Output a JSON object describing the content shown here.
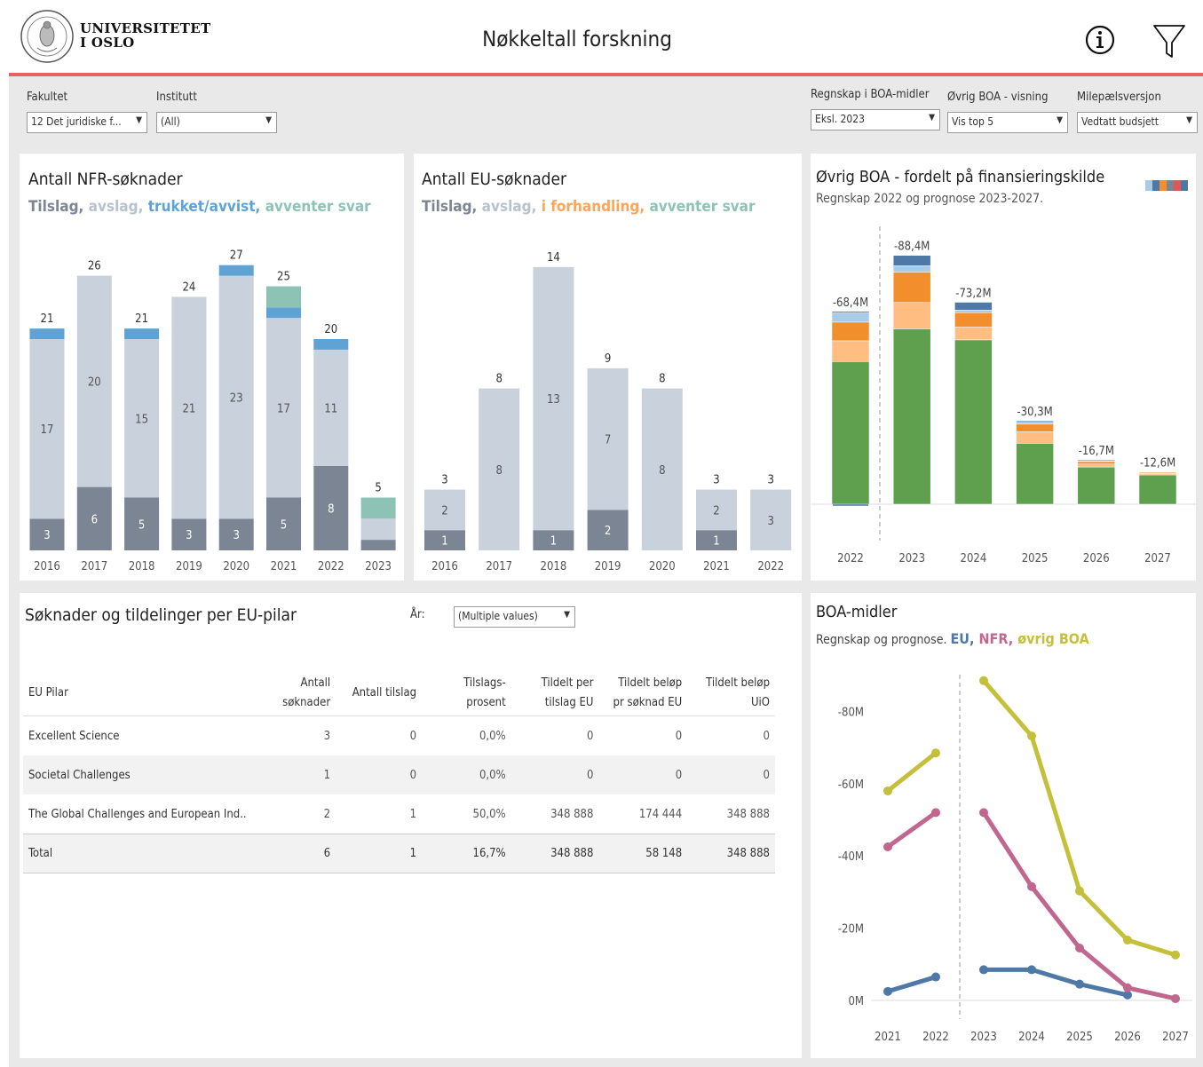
{
  "header": {
    "university_line1": "UNIVERSITETET",
    "university_line2": "I OSLO",
    "title": "Nøkkeltall forskning",
    "info_icon": "info-icon",
    "filter_icon": "filter-icon"
  },
  "filters": {
    "fakultet": {
      "label": "Fakultet",
      "value": "12 Det juridiske f..."
    },
    "institutt": {
      "label": "Institutt",
      "value": "(All)"
    },
    "regnskap": {
      "label": "Regnskap i BOA-midler",
      "value": "Eksl. 2023"
    },
    "ovrig": {
      "label": "Øvrig BOA - visning",
      "value": "Vis top 5"
    },
    "milepael": {
      "label": "Milepælsversjon",
      "value": "Vedtatt budsjett"
    }
  },
  "colors": {
    "tilslag": "#7b8593",
    "avslag": "#c8d1dc",
    "trukket": "#5fa2d4",
    "avventer": "#8cc3b5",
    "forhandling": "#f9a65a",
    "eu_line": "#4e79a7",
    "nfr_line": "#c1668e",
    "boa_line": "#c5c03b",
    "green": "#5fa04e",
    "orange": "#f28e2b",
    "light_orange": "#ffbd82",
    "light_blue": "#a8cce8",
    "dark_blue": "#4e79a7",
    "accent": "#e46464"
  },
  "nfr": {
    "title": "Antall NFR-søknader",
    "legend": {
      "tilslag": "Tilslag",
      "avslag": "avslag",
      "trukket": "trukket/avvist",
      "avventer": "avventer svar",
      "sep": ", "
    }
  },
  "eu": {
    "title": "Antall EU-søknader",
    "legend": {
      "tilslag": "Tilslag",
      "avslag": "avslag",
      "forhandling": "i forhandling",
      "avventer": "avventer svar",
      "sep": ", "
    }
  },
  "ovrig_boa": {
    "title_bold": "Øvrig BOA",
    "title_rest": " - fordelt på finansieringskilde",
    "subtitle": "Regnskap 2022 og prognose 2023-2027."
  },
  "boa_midler": {
    "title": "BOA-midler",
    "subtitle_prefix": "Regnskap og prognose. ",
    "eu": "EU",
    "nfr": "NFR",
    "ovrig": "øvrig BOA",
    "sep": ", "
  },
  "pilar": {
    "title": "Søknader og tildelinger per EU-pilar",
    "year_label": "År:",
    "year_value": "(Multiple values)",
    "columns": [
      [
        "EU Pilar"
      ],
      [
        "Antall",
        "søknader"
      ],
      [
        "Antall tilslag"
      ],
      [
        "Tilslags-",
        "prosent"
      ],
      [
        "Tildelt per",
        "tilslag EU"
      ],
      [
        "Tildelt beløp",
        "pr søknad EU"
      ],
      [
        "Tildelt beløp",
        "UiO"
      ]
    ],
    "rows": [
      [
        "Excellent Science",
        "3",
        "0",
        "0,0%",
        "0",
        "0",
        "0"
      ],
      [
        "Societal Challenges",
        "1",
        "0",
        "0,0%",
        "0",
        "0",
        "0"
      ],
      [
        "The Global Challenges and European Ind..",
        "2",
        "1",
        "50,0%",
        "348 888",
        "174 444",
        "348 888"
      ]
    ],
    "total": [
      "Total",
      "6",
      "1",
      "16,7%",
      "348 888",
      "58 148",
      "348 888"
    ]
  },
  "chart_data": [
    {
      "type": "bar",
      "name": "nfr",
      "stacked": true,
      "categories": [
        "2016",
        "2017",
        "2018",
        "2019",
        "2020",
        "2021",
        "2022",
        "2023"
      ],
      "series": [
        {
          "name": "Tilslag",
          "values": [
            3,
            6,
            5,
            3,
            3,
            5,
            8,
            1
          ]
        },
        {
          "name": "avslag",
          "values": [
            17,
            20,
            15,
            21,
            23,
            17,
            11,
            2
          ]
        },
        {
          "name": "trukket/avvist",
          "values": [
            1,
            0,
            1,
            0,
            1,
            1,
            1,
            0
          ]
        },
        {
          "name": "avventer svar",
          "values": [
            0,
            0,
            0,
            0,
            0,
            2,
            0,
            2
          ]
        }
      ],
      "totals": [
        21,
        26,
        21,
        24,
        27,
        25,
        20,
        5
      ],
      "labels": {
        "tilslag": [
          "3",
          "6",
          "5",
          "3",
          "3",
          "5",
          "8",
          ""
        ],
        "avslag": [
          "17",
          "20",
          "15",
          "21",
          "23",
          "17",
          "11",
          ""
        ]
      },
      "ylim": [
        0,
        30
      ]
    },
    {
      "type": "bar",
      "name": "eu",
      "stacked": true,
      "categories": [
        "2016",
        "2017",
        "2018",
        "2019",
        "2020",
        "2021",
        "2022"
      ],
      "series": [
        {
          "name": "Tilslag",
          "values": [
            1,
            0,
            1,
            2,
            0,
            1,
            0
          ]
        },
        {
          "name": "avslag",
          "values": [
            2,
            8,
            13,
            7,
            8,
            2,
            3
          ]
        }
      ],
      "totals": [
        3,
        8,
        14,
        9,
        8,
        3,
        3
      ],
      "labels": {
        "tilslag": [
          "1",
          "",
          "1",
          "2",
          "",
          "1",
          ""
        ],
        "avslag": [
          "2",
          "8",
          "13",
          "7",
          "8",
          "2",
          "3"
        ]
      },
      "ylim": [
        0,
        16
      ]
    },
    {
      "type": "bar",
      "name": "ovrig_boa",
      "stacked": true,
      "categories": [
        "2022",
        "2023",
        "2024",
        "2025",
        "2026",
        "2027"
      ],
      "series": [
        {
          "name": "green",
          "values": [
            61.8,
            76.0,
            71.2,
            26.4,
            16.1,
            12.7
          ]
        },
        {
          "name": "light_orange",
          "values": [
            9.0,
            11.4,
            5.6,
            5.0,
            1.3,
            0.6
          ]
        },
        {
          "name": "orange",
          "values": [
            8.1,
            13.2,
            6.2,
            3.3,
            1.1,
            0.5
          ]
        },
        {
          "name": "light_blue",
          "values": [
            4.0,
            2.7,
            1.1,
            0.8,
            0.3,
            0.1
          ]
        },
        {
          "name": "dark_blue",
          "values": [
            0.6,
            4.5,
            3.4,
            0.6,
            0.4,
            0.1
          ]
        }
      ],
      "total_labels": [
        "-68,4M",
        "-88,4M",
        "-73,2M",
        "-30,3M",
        "-16,7M",
        "-12,6M"
      ],
      "ylim": [
        -2,
        120
      ]
    },
    {
      "type": "line",
      "name": "boa_midler",
      "x": [
        "2021",
        "2022",
        "2023",
        "2024",
        "2025",
        "2026",
        "2027"
      ],
      "ytick_labels": [
        "0M",
        "-20M",
        "-40M",
        "-60M",
        "-80M"
      ],
      "yticks": [
        0,
        20,
        40,
        60,
        80
      ],
      "series": [
        {
          "name": "EU",
          "segments": [
            [
              [
                2021,
                2.5
              ],
              [
                2022,
                6.5
              ]
            ],
            [
              [
                2023,
                8.5
              ],
              [
                2024,
                8.5
              ],
              [
                2025,
                4.5
              ],
              [
                2026,
                1.5
              ]
            ]
          ]
        },
        {
          "name": "NFR",
          "segments": [
            [
              [
                2021,
                42.5
              ],
              [
                2022,
                52
              ]
            ],
            [
              [
                2023,
                52
              ],
              [
                2024,
                31.5
              ],
              [
                2025,
                14.5
              ],
              [
                2026,
                3.5
              ],
              [
                2027,
                0.5
              ]
            ]
          ]
        },
        {
          "name": "øvrig BOA",
          "segments": [
            [
              [
                2021,
                58
              ],
              [
                2022,
                68.5
              ]
            ],
            [
              [
                2023,
                88.5
              ],
              [
                2024,
                73.2
              ],
              [
                2025,
                30.3
              ],
              [
                2026,
                16.7
              ],
              [
                2027,
                12.6
              ]
            ]
          ]
        }
      ],
      "ylim": [
        -4,
        94
      ]
    }
  ]
}
